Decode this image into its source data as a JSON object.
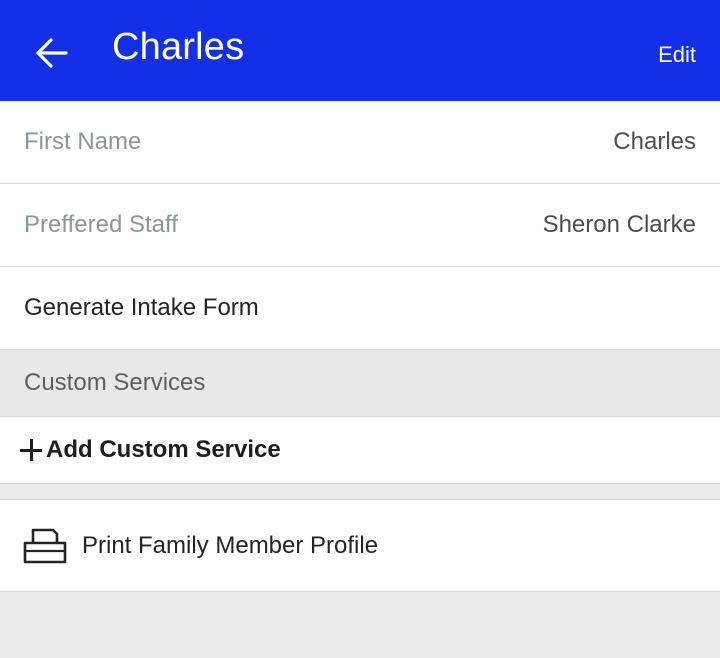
{
  "header": {
    "title": "Charles",
    "edit_label": "Edit",
    "back_icon": "arrow-left-icon",
    "background": "#1330e8"
  },
  "fields": [
    {
      "label": "First Name",
      "value": "Charles"
    },
    {
      "label": "Preffered Staff",
      "value": "Sheron Clarke"
    }
  ],
  "actions": {
    "generate_intake": "Generate Intake Form"
  },
  "custom_services": {
    "header": "Custom Services",
    "add_label": "Add Custom Service",
    "add_icon": "plus-icon"
  },
  "print": {
    "label": "Print Family Member Profile",
    "icon": "printer-icon"
  }
}
